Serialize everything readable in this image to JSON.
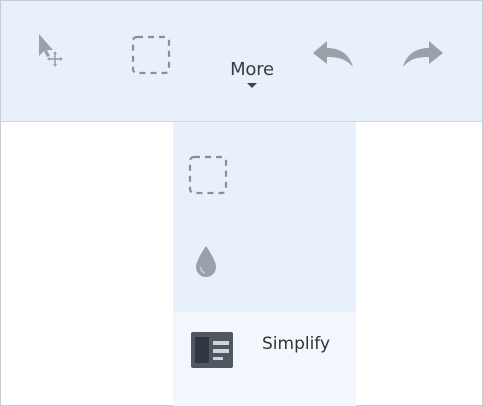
{
  "toolbar": {
    "tools": [
      {
        "icon": "move-select-icon"
      },
      {
        "icon": "rectangle-select-icon"
      }
    ],
    "more_label": "More",
    "undo_icon": "undo-icon",
    "redo_icon": "redo-icon"
  },
  "dropdown": {
    "items": [
      {
        "icon": "rectangle-select-icon",
        "label": ""
      },
      {
        "icon": "drop-icon",
        "label": ""
      },
      {
        "icon": "simplify-icon",
        "label": "Simplify"
      }
    ]
  },
  "colors": {
    "toolbar_bg": "#e8f0fb",
    "icon_gray": "#9aa1a8",
    "selection_dash": "#8a9098"
  }
}
